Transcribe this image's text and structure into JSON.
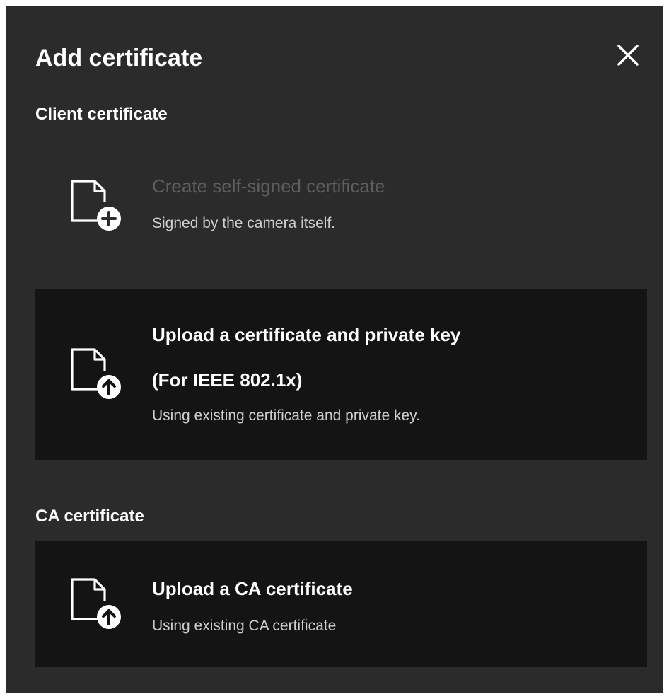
{
  "dialog": {
    "title": "Add certificate",
    "close_icon": "close-icon"
  },
  "client_section": {
    "heading": "Client certificate",
    "options": [
      {
        "title": "Create self-signed certificate",
        "description": "Signed by the camera itself.",
        "icon": "document-add-icon",
        "state": "disabled"
      },
      {
        "title": "Upload a certificate and private key",
        "subtitle": "(For IEEE 802.1x)",
        "description": "Using existing certificate and private key.",
        "icon": "document-upload-icon",
        "state": "highlighted"
      }
    ]
  },
  "ca_section": {
    "heading": "CA certificate",
    "options": [
      {
        "title": "Upload a CA certificate",
        "description": "Using existing CA certificate",
        "icon": "document-upload-icon",
        "state": "highlighted"
      }
    ]
  },
  "colors": {
    "dialog_background": "#2b2b2b",
    "card_background": "#141414",
    "text_primary": "#ffffff",
    "text_secondary": "#cfcfcf",
    "text_disabled": "#5e5e5e"
  }
}
